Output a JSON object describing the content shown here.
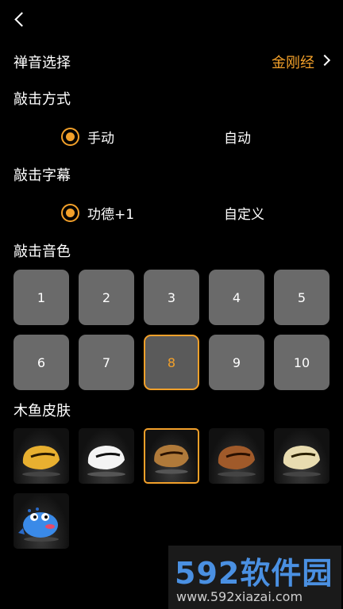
{
  "header": {
    "back_icon": "chevron-left-icon"
  },
  "zen_sound": {
    "label": "禅音选择",
    "value": "金刚经"
  },
  "strike_mode": {
    "title": "敲击方式",
    "options": [
      {
        "label": "手动",
        "selected": true
      },
      {
        "label": "自动",
        "selected": false
      }
    ]
  },
  "strike_caption": {
    "title": "敲击字幕",
    "options": [
      {
        "label": "功德+1",
        "selected": true
      },
      {
        "label": "自定义",
        "selected": false
      }
    ]
  },
  "strike_tone": {
    "title": "敲击音色",
    "items": [
      "1",
      "2",
      "3",
      "4",
      "5",
      "6",
      "7",
      "8",
      "9",
      "10"
    ],
    "selected": "8"
  },
  "fish_skin": {
    "title": "木鱼皮肤",
    "items": [
      {
        "name": "yellow-fish-skin",
        "color": "#e8b030"
      },
      {
        "name": "white-fish-skin",
        "color": "#f4f4f4"
      },
      {
        "name": "bronze-fish-skin",
        "color": "#b07a3a"
      },
      {
        "name": "wood-fish-skin",
        "color": "#a05a2a"
      },
      {
        "name": "cream-fish-skin",
        "color": "#e8dcb0"
      },
      {
        "name": "blue-cartoon-fish-skin",
        "color": "#3a8ae8"
      }
    ],
    "selected_index": 2
  },
  "watermark": {
    "main": "592软件园",
    "sub": "www.592xiazai.com"
  },
  "colors": {
    "accent": "#f2a02a",
    "tile": "#6a6a6a",
    "background": "#000000"
  }
}
